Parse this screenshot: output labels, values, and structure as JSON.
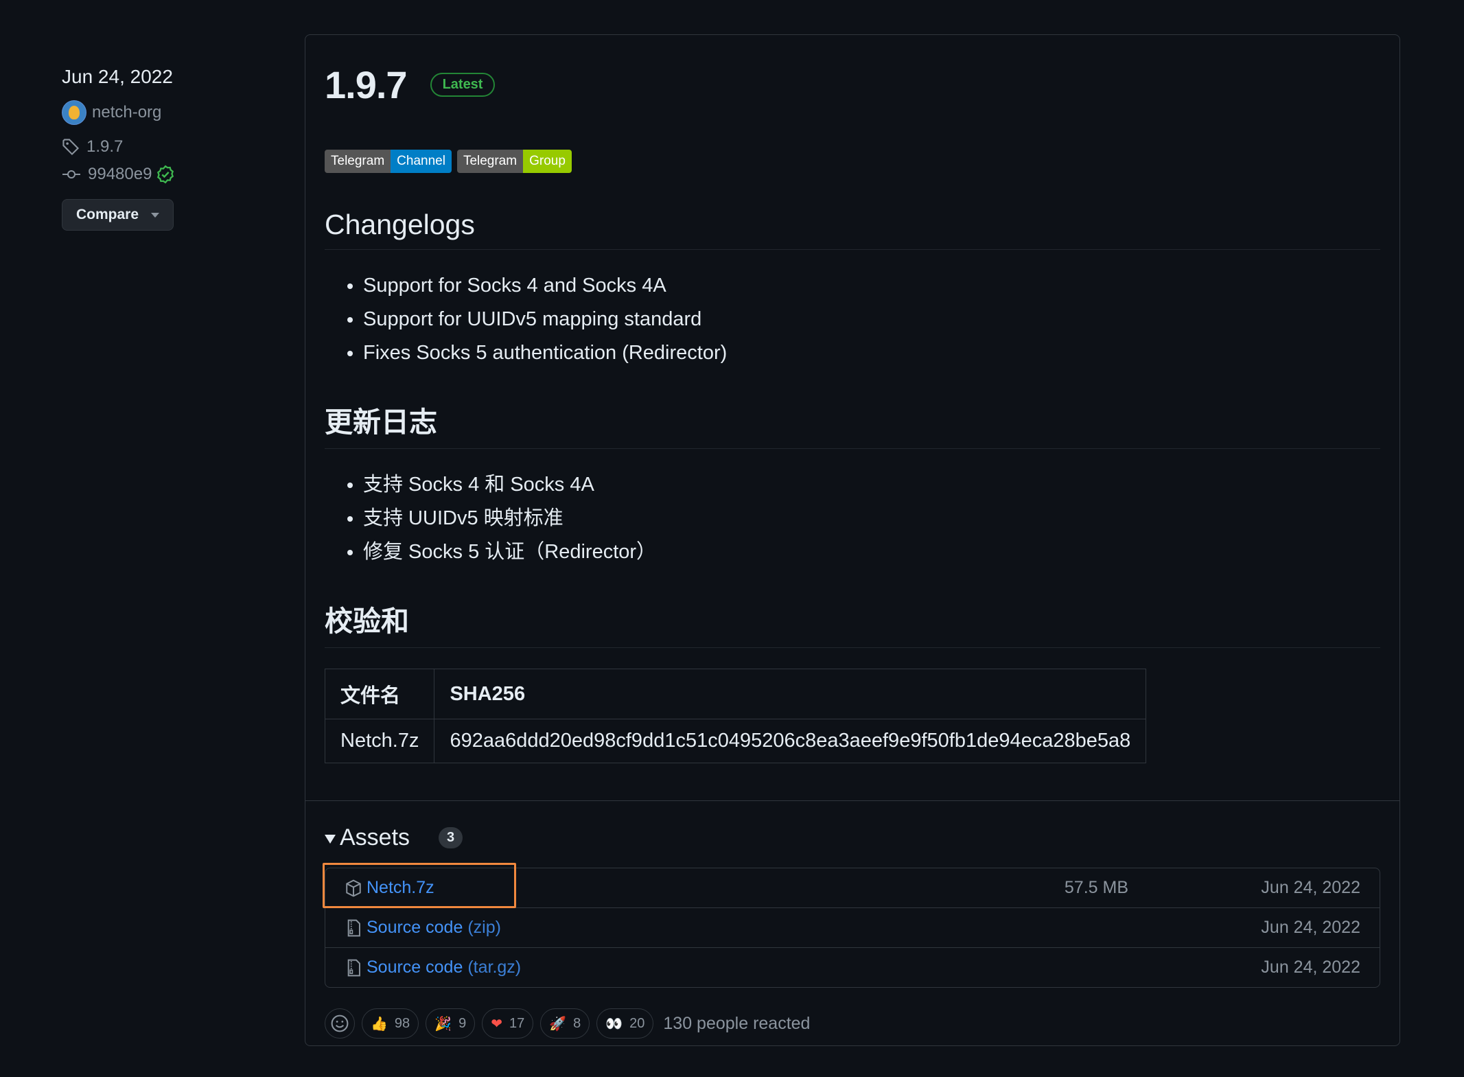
{
  "meta": {
    "date": "Jun 24, 2022",
    "author": "netch-org",
    "tag": "1.9.7",
    "commit": "99480e9",
    "compare_label": "Compare"
  },
  "release": {
    "version": "1.9.7",
    "latest_label": "Latest",
    "badges": [
      {
        "left": "Telegram",
        "right": "Channel",
        "color": "#007ec6"
      },
      {
        "left": "Telegram",
        "right": "Group",
        "color": "#97ca00"
      }
    ],
    "changelogs_heading": "Changelogs",
    "changelogs": [
      "Support for Socks 4 and Socks 4A",
      "Support for UUIDv5 mapping standard",
      "Fixes Socks 5 authentication (Redirector)"
    ],
    "zh_heading": "更新日志",
    "zh_changelogs": [
      "支持 Socks 4 和 Socks 4A",
      "支持 UUIDv5 映射标准",
      "修复 Socks 5 认证（Redirector）"
    ],
    "checksum_heading": "校验和",
    "checksum_table": {
      "headers": [
        "文件名",
        "SHA256"
      ],
      "rows": [
        [
          "Netch.7z",
          "692aa6ddd20ed98cf9dd1c51c0495206c8ea3aeef9e9f50fb1de94eca28be5a8"
        ]
      ]
    }
  },
  "assets": {
    "label": "Assets",
    "count": "3",
    "items": [
      {
        "name": "Netch.7z",
        "suffix": "",
        "size": "57.5 MB",
        "date": "Jun 24, 2022"
      },
      {
        "name": "Source code",
        "suffix": " (zip)",
        "size": "",
        "date": "Jun 24, 2022"
      },
      {
        "name": "Source code",
        "suffix": " (tar.gz)",
        "size": "",
        "date": "Jun 24, 2022"
      }
    ]
  },
  "reactions": {
    "items": [
      {
        "emoji": "👍",
        "count": "98"
      },
      {
        "emoji": "🎉",
        "count": "9"
      },
      {
        "emoji": "❤",
        "count": "17"
      },
      {
        "emoji": "🚀",
        "count": "8"
      },
      {
        "emoji": "👀",
        "count": "20"
      }
    ],
    "summary": "130 people reacted"
  },
  "colors": {
    "background": "#0d1117",
    "link": "#4493f8",
    "latest_green": "#3fb950",
    "highlight": "#f0883e"
  }
}
